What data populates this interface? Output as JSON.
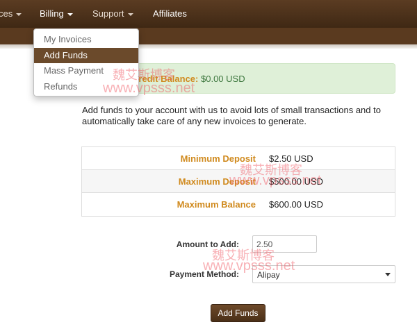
{
  "nav": {
    "items": [
      {
        "label": "ces",
        "has_caret": true
      },
      {
        "label": "Billing",
        "has_caret": true
      },
      {
        "label": "Support",
        "has_caret": true
      },
      {
        "label": "Affiliates",
        "has_caret": false
      }
    ]
  },
  "billing_menu": {
    "items": [
      {
        "label": "My Invoices"
      },
      {
        "label": "Add Funds",
        "active": true
      },
      {
        "label": "Mass Payment"
      },
      {
        "label": "Refunds"
      }
    ]
  },
  "alert": {
    "label": "Credit Balance:",
    "value": "$0.00 USD"
  },
  "intro_text": "Add funds to your account with us to avoid lots of small transactions and to automatically take care of any new invoices to generate.",
  "limits": [
    {
      "label": "Minimum Deposit",
      "value": "$2.50 USD"
    },
    {
      "label": "Maximum Deposit",
      "value": "$500.00 USD"
    },
    {
      "label": "Maximum Balance",
      "value": "$600.00 USD"
    }
  ],
  "form": {
    "amount_label": "Amount to Add:",
    "amount_value": "2.50",
    "payment_label": "Payment Method:",
    "payment_selected": "Alipay",
    "submit_label": "Add Funds"
  },
  "watermark": {
    "cn": "魏艾斯博客",
    "url": "www.vpsss.net"
  },
  "colors": {
    "nav_brown": "#4a2f18",
    "accent_orange": "#d08a1e",
    "alert_green_bg": "#dff0d8",
    "alert_green_text": "#3c763d"
  }
}
